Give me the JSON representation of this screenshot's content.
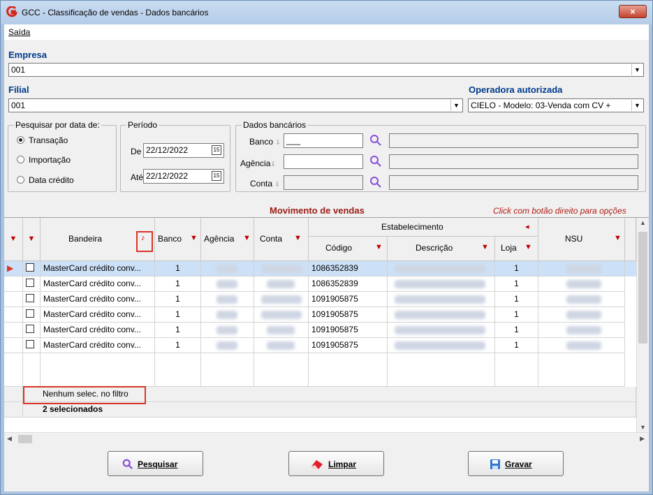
{
  "window": {
    "title": "GCC - Classificação de vendas - Dados bancários",
    "close_label": "×"
  },
  "menu": {
    "saida": "Saída"
  },
  "empresa": {
    "label": "Empresa",
    "value": "001"
  },
  "filial": {
    "label": "Filial",
    "value": "001"
  },
  "operadora": {
    "label": "Operadora autorizada",
    "value": "CIELO - Modelo: 03-Venda com CV + "
  },
  "pesquisar": {
    "title": "Pesquisar por data de:",
    "options": [
      "Transação",
      "Importação",
      "Data crédito"
    ],
    "selected": "Transação"
  },
  "periodo": {
    "title": "Período",
    "de_label": "De",
    "de_value": "22/12/2022",
    "ate_label": "Até",
    "ate_value": "22/12/2022"
  },
  "dados": {
    "title": "Dados bancários",
    "banco": "Banco",
    "agencia": "Agência",
    "conta": "Conta",
    "banco_value": "___"
  },
  "grid_caption": {
    "title": "Movimento de vendas",
    "hint": "Click com botão direito para opções"
  },
  "columns": {
    "bandeira": "Bandeira",
    "banco": "Banco",
    "agencia": "Agência",
    "conta": "Conta",
    "estabelecimento": "Estabelecimento",
    "codigo": "Código",
    "descricao": "Descrição",
    "loja": "Loja",
    "nsu": "NSU"
  },
  "rows": [
    {
      "bandeira": "MasterCard crédito conv...",
      "banco": "1",
      "codigo": "1086352839",
      "loja": "1"
    },
    {
      "bandeira": "MasterCard crédito conv...",
      "banco": "1",
      "codigo": "1086352839",
      "loja": "1"
    },
    {
      "bandeira": "MasterCard crédito conv...",
      "banco": "1",
      "codigo": "1091905875",
      "loja": "1"
    },
    {
      "bandeira": "MasterCard crédito conv...",
      "banco": "1",
      "codigo": "1091905875",
      "loja": "1"
    },
    {
      "bandeira": "MasterCard crédito conv...",
      "banco": "1",
      "codigo": "1091905875",
      "loja": "1"
    },
    {
      "bandeira": "MasterCard crédito conv...",
      "banco": "1",
      "codigo": "1091905875",
      "loja": "1"
    }
  ],
  "filter_row": "Nenhum selec. no filtro",
  "summary_row": "2 selecionados",
  "buttons": {
    "pesquisar": "Pesquisar",
    "limpar": "Limpar",
    "gravar": "Gravar"
  },
  "colors": {
    "accent": "#003a8c",
    "highlight": "#d9352a",
    "selection": "#cce0f7"
  }
}
